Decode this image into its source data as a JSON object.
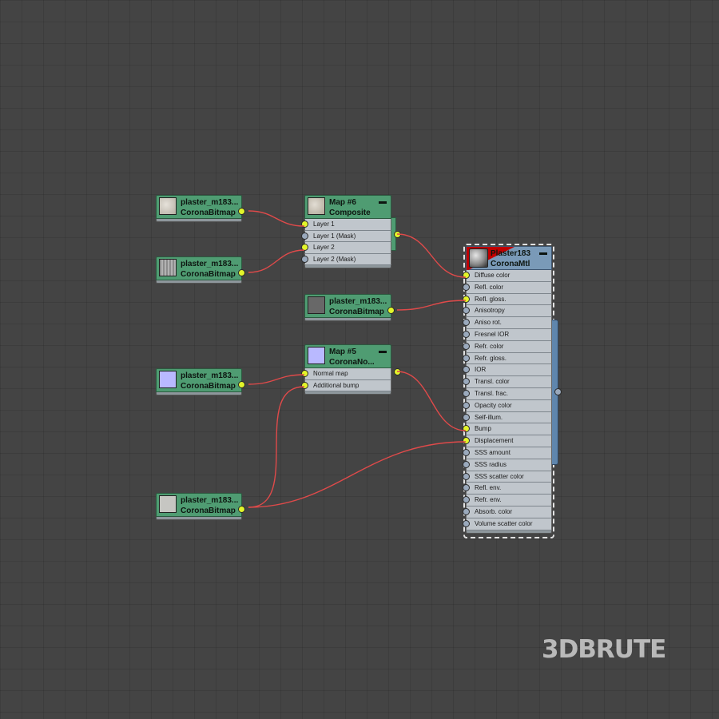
{
  "nodes": {
    "bitmap1": {
      "name": "plaster_m183...",
      "type": "CoronaBitmap",
      "thumb_icon": "plaster-texture-thumbnail"
    },
    "bitmap2": {
      "name": "plaster_m183...",
      "type": "CoronaBitmap",
      "thumb_icon": "plaster-texture-thumbnail"
    },
    "bitmap3": {
      "name": "plaster_m183...",
      "type": "CoronaBitmap",
      "thumb_icon": "gray-texture-thumbnail"
    },
    "bitmap4": {
      "name": "plaster_m183...",
      "type": "CoronaBitmap",
      "thumb_icon": "normal-map-thumbnail"
    },
    "bitmap5": {
      "name": "plaster_m183...",
      "type": "CoronaBitmap",
      "thumb_icon": "plaster-texture-thumbnail"
    },
    "composite": {
      "name": "Map #6",
      "type": "Composite",
      "minimize": "▬",
      "slots": [
        "Layer 1",
        "Layer 1 (Mask)",
        "Layer 2",
        "Layer 2 (Mask)"
      ]
    },
    "normal": {
      "name": "Map #5",
      "type": "CoronaNo...",
      "minimize": "▬",
      "slots": [
        "Normal map",
        "Additional bump"
      ]
    },
    "material": {
      "name": "Plaster183",
      "type": "CoronaMtl",
      "minimize": "▬",
      "slots": [
        "Diffuse color",
        "Refl. color",
        "Refl. gloss.",
        "Anisotropy",
        "Aniso rot.",
        "Fresnel IOR",
        "Refr. color",
        "Refr. gloss.",
        "IOR",
        "Transl. color",
        "Transl. frac.",
        "Opacity color",
        "Self-illum.",
        "Bump",
        "Displacement",
        "SSS amount",
        "SSS radius",
        "SSS scatter color",
        "Refl. env.",
        "Refr. env.",
        "Absorb. color",
        "Volume scatter color"
      ]
    }
  },
  "colors": {
    "wire": "#e04a4a",
    "socket_connected": "#e3f52a",
    "socket_free": "#9aa9bc",
    "map_header": "#4f9c72",
    "material_header": "#7a9ab8"
  },
  "watermark": "3DBRUTE"
}
